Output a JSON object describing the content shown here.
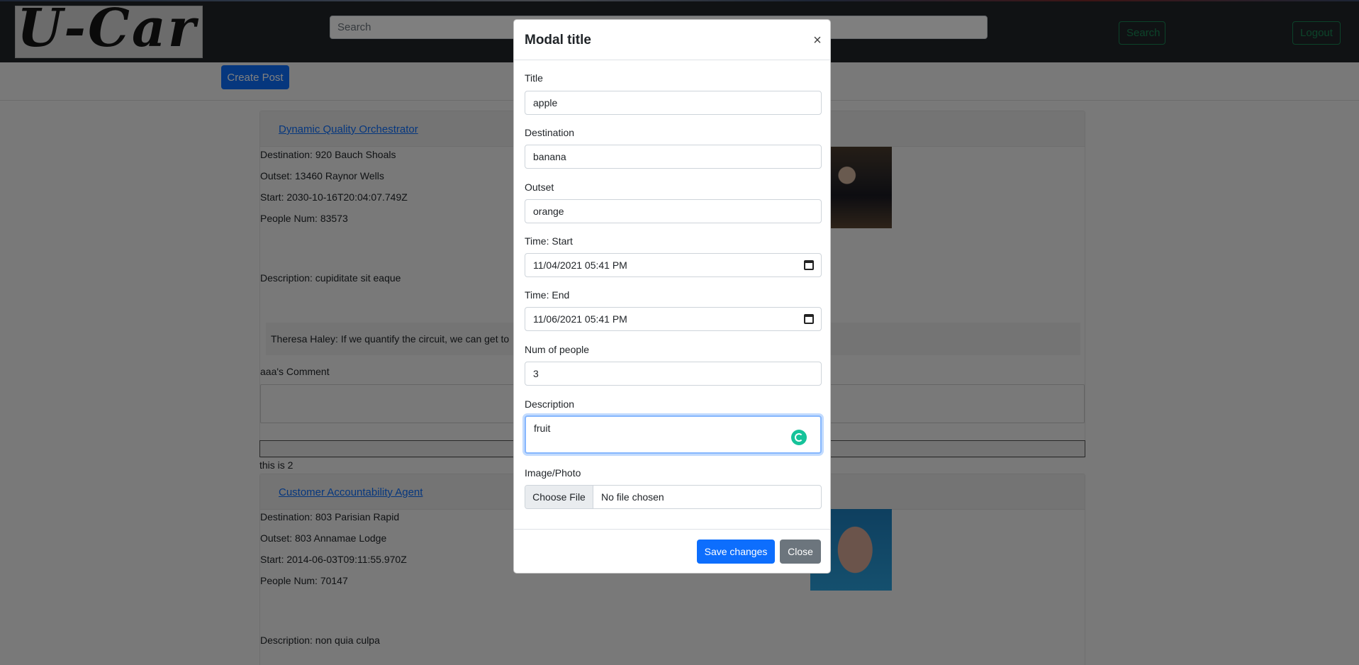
{
  "navbar": {
    "logo_text": "U-Car",
    "search_placeholder": "Search",
    "search_button": "Search",
    "logout_button": "Logout"
  },
  "toolbar": {
    "create_post": "Create Post"
  },
  "posts": [
    {
      "title": "Dynamic Quality Orchestrator",
      "destination": "Destination: 920 Bauch Shoals",
      "outset": "Outset: 13460 Raynor Wells",
      "start": "Start: 2030-10-16T20:04:07.749Z",
      "people": "People Num: 83573",
      "description": "Description: cupiditate sit eaque",
      "comment": "Theresa Haley: If we quantify the circuit, we can get to",
      "comment_label": "aaa's Comment",
      "footer_text": "this is 2"
    },
    {
      "title": "Customer Accountability Agent",
      "destination": "Destination: 803 Parisian Rapid",
      "outset": "Outset: 803 Annamae Lodge",
      "start": "Start: 2014-06-03T09:11:55.970Z",
      "people": "People Num: 70147",
      "description": "Description: non quia culpa"
    }
  ],
  "modal": {
    "title": "Modal title",
    "close_glyph": "×",
    "fields": {
      "title_label": "Title",
      "title_value": "apple",
      "destination_label": "Destination",
      "destination_value": "banana",
      "outset_label": "Outset",
      "outset_value": "orange",
      "start_label": "Time: Start",
      "start_value": "11/04/2021 05:41 PM",
      "end_label": "Time: End",
      "end_value": "11/06/2021 05:41 PM",
      "people_label": "Num of people",
      "people_value": "3",
      "description_label": "Description",
      "description_value": "fruit",
      "image_label": "Image/Photo",
      "file_button": "Choose File",
      "file_status": "No file chosen"
    },
    "save_button": "Save changes",
    "close_button": "Close"
  },
  "colors": {
    "primary": "#0d6efd",
    "success": "#198754",
    "secondary": "#6c757d",
    "navbar": "#212529"
  }
}
